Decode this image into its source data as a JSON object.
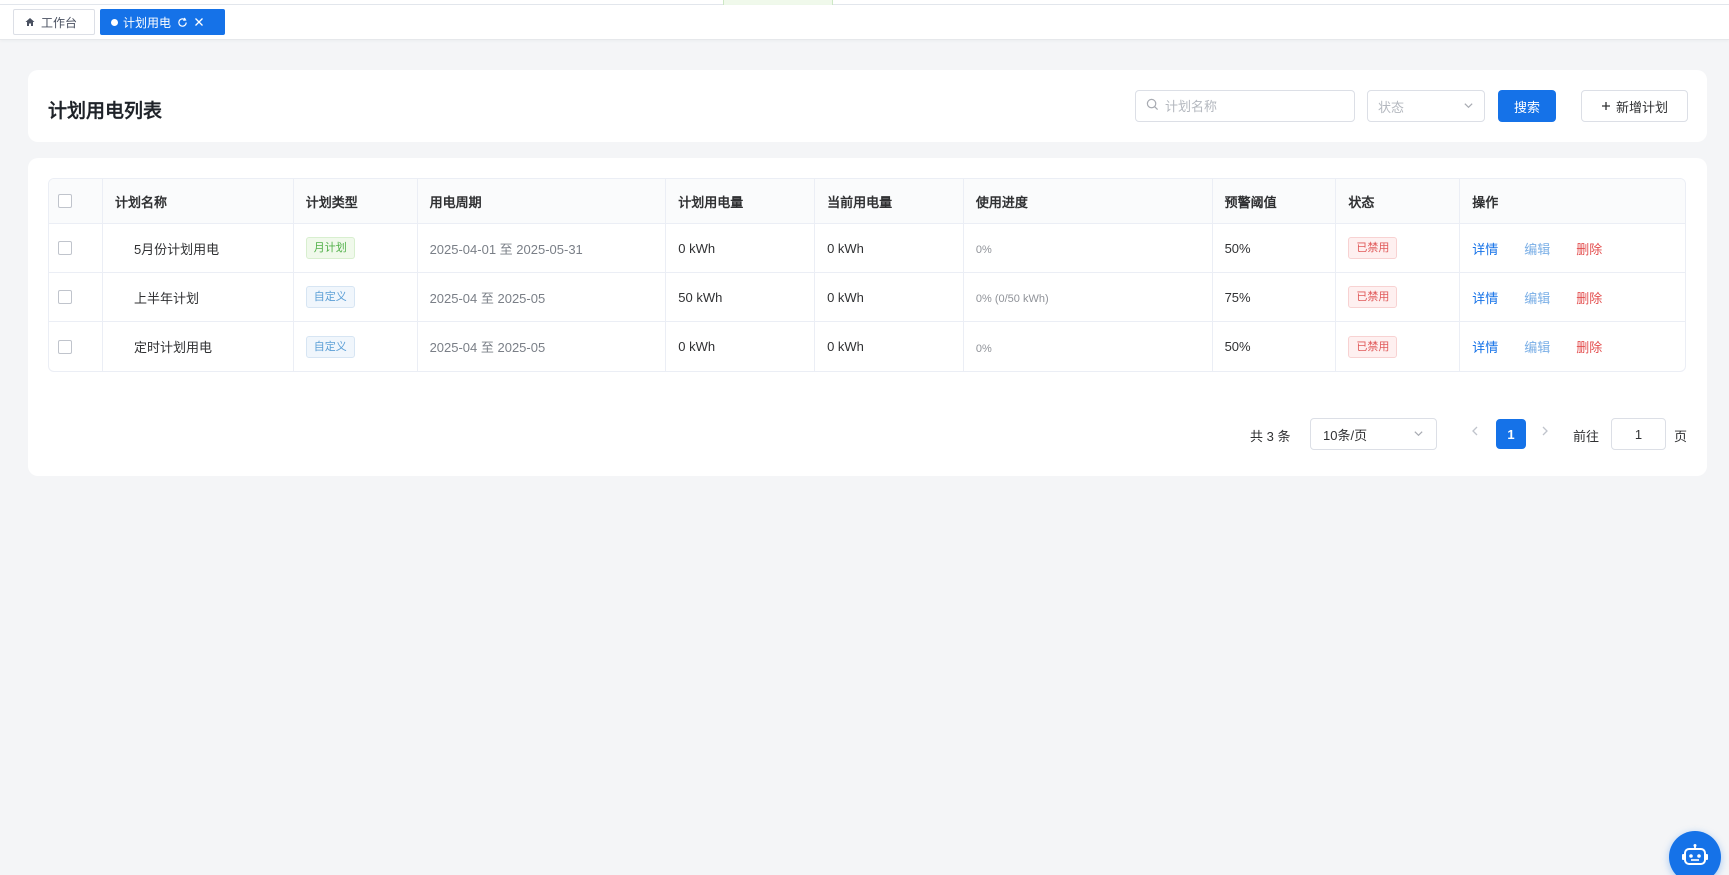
{
  "tabs": [
    {
      "label": "工作台",
      "icon": "home-icon"
    },
    {
      "label": "计划用电",
      "icon": "dot-icon",
      "active": true
    }
  ],
  "header": {
    "title": "计划用电列表",
    "search_placeholder": "计划名称",
    "status_placeholder": "状态",
    "search_button": "搜索",
    "add_button": "新增计划"
  },
  "table": {
    "columns": [
      "计划名称",
      "计划类型",
      "用电周期",
      "计划用电量",
      "当前用电量",
      "使用进度",
      "预警阈值",
      "状态",
      "操作"
    ],
    "rows": [
      {
        "name": "5月份计划用电",
        "type": "月计划",
        "type_color": "green",
        "period": "2025-04-01 至 2025-05-31",
        "planned": "0 kWh",
        "current": "0 kWh",
        "progress": "0%",
        "threshold": "50%",
        "status": "已禁用"
      },
      {
        "name": "上半年计划",
        "type": "自定义",
        "type_color": "blue",
        "period": "2025-04 至 2025-05",
        "planned": "50 kWh",
        "current": "0 kWh",
        "progress": "0% (0/50 kWh)",
        "threshold": "75%",
        "status": "已禁用"
      },
      {
        "name": "定时计划用电",
        "type": "自定义",
        "type_color": "blue",
        "period": "2025-04 至 2025-05",
        "planned": "0 kWh",
        "current": "0 kWh",
        "progress": "0%",
        "threshold": "50%",
        "status": "已禁用"
      }
    ],
    "actions": {
      "detail": "详情",
      "edit": "编辑",
      "delete": "删除"
    }
  },
  "pagination": {
    "total": "共 3 条",
    "page_size": "10条/页",
    "current_page": "1",
    "goto_label": "前往",
    "goto_value": "1",
    "page_suffix": "页"
  },
  "colors": {
    "primary": "#1572e8",
    "danger": "#e34d4d",
    "success": "#52b14a"
  }
}
